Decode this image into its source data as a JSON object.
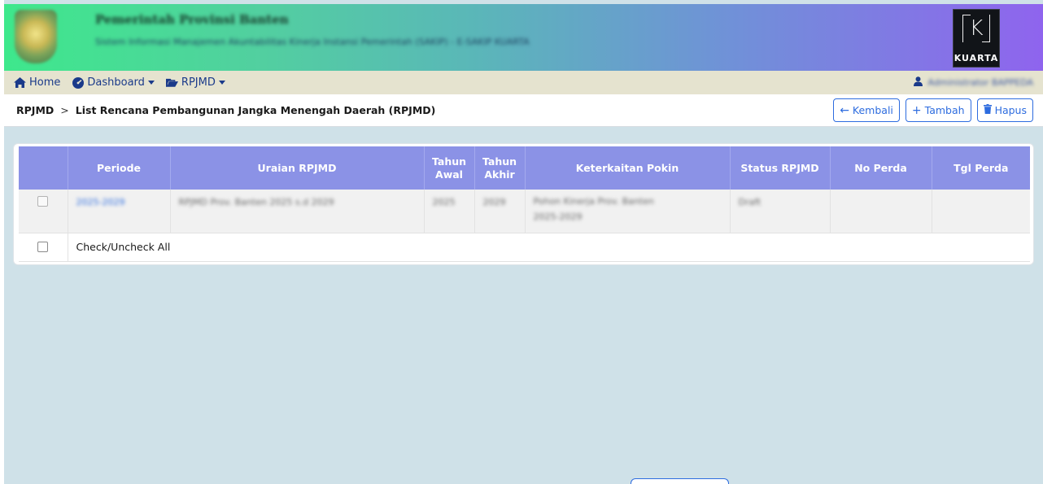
{
  "header": {
    "title": "Pemerintah Provinsi Banten",
    "subtitle": "Sistem Informasi Manajemen Akuntabilitas Kinerja Instansi Pemerintah (SAKIP) - E-SAKIP KUARTA",
    "brand_text": "KUARTA",
    "brand_letter": "K"
  },
  "navbar": {
    "home": "Home",
    "dashboard": "Dashboard",
    "rpjmd": "RPJMD",
    "user": "Administrator BAPPEDA",
    "accent_color": "#1a3a8a"
  },
  "breadcrumb": {
    "root": "RPJMD",
    "separator": ">",
    "current": "List Rencana Pembangunan Jangka Menengah Daerah (RPJMD)"
  },
  "actions": {
    "back": "Kembali",
    "add": "Tambah",
    "delete": "Hapus"
  },
  "table": {
    "headers": {
      "periode": "Periode",
      "uraian": "Uraian RPJMD",
      "tahun_awal_1": "Tahun",
      "tahun_awal_2": "Awal",
      "tahun_akhir_1": "Tahun",
      "tahun_akhir_2": "Akhir",
      "pokin": "Keterkaitan Pokin",
      "status": "Status RPJMD",
      "no_perda": "No Perda",
      "tgl_perda": "Tgl Perda"
    },
    "rows": [
      {
        "periode": "2025-2029",
        "uraian": "RPJMD Prov. Banten 2025 s.d 2029",
        "tahun_awal": "2025",
        "tahun_akhir": "2029",
        "pokin_1": "Pohon Kinerja Prov. Banten",
        "pokin_2": "2025-2029",
        "status": "Draft",
        "no_perda": "",
        "tgl_perda": ""
      }
    ],
    "check_all_label": "Check/Uncheck All",
    "header_color": "#8b92e6"
  }
}
